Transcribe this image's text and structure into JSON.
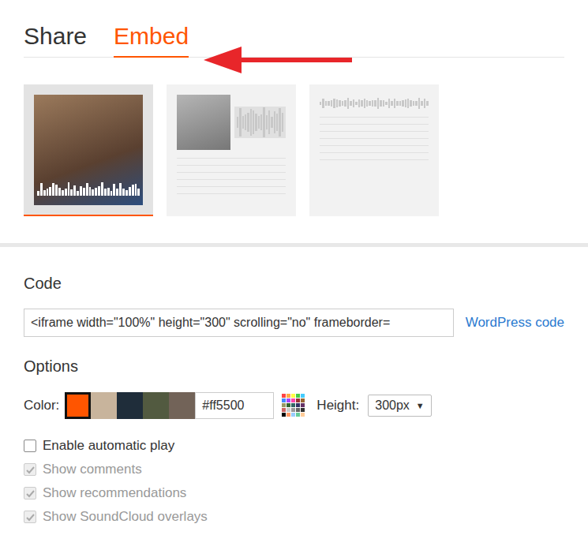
{
  "tabs": [
    {
      "label": "Share",
      "selected": false
    },
    {
      "label": "Embed",
      "selected": true
    }
  ],
  "previews": [
    {
      "kind": "artwork",
      "selected": true
    },
    {
      "kind": "classic",
      "selected": false
    },
    {
      "kind": "mini",
      "selected": false
    }
  ],
  "code": {
    "heading": "Code",
    "value": "<iframe width=\"100%\" height=\"300\" scrolling=\"no\" frameborder=",
    "link": "WordPress code"
  },
  "options": {
    "heading": "Options",
    "color_label": "Color:",
    "swatches": [
      {
        "color": "#ff5500",
        "selected": true
      },
      {
        "color": "#c8b49c",
        "selected": false
      },
      {
        "color": "#1f2d3a",
        "selected": false
      },
      {
        "color": "#525a40",
        "selected": false
      },
      {
        "color": "#726358",
        "selected": false
      }
    ],
    "color_value": "#ff5500",
    "height_label": "Height:",
    "height_value": "300px",
    "height_arrow": "▼"
  },
  "checkboxes": [
    {
      "label": "Enable automatic play",
      "checked": false,
      "disabled": false
    },
    {
      "label": "Show comments",
      "checked": true,
      "disabled": true
    },
    {
      "label": "Show recommendations",
      "checked": true,
      "disabled": true
    },
    {
      "label": "Show SoundCloud overlays",
      "checked": true,
      "disabled": true
    }
  ]
}
